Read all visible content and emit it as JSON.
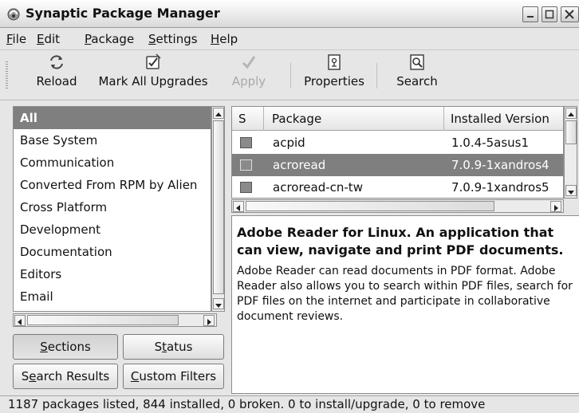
{
  "window": {
    "title": "Synaptic Package Manager",
    "app_icon": "synaptic-icon",
    "controls": [
      "minimize-icon",
      "maximize-icon",
      "close-icon"
    ]
  },
  "menu": [
    {
      "mnemonic": "F",
      "rest": "ile"
    },
    {
      "mnemonic": "E",
      "rest": "dit"
    },
    {
      "mnemonic": "P",
      "rest": "ackage"
    },
    {
      "mnemonic": "S",
      "rest": "ettings"
    },
    {
      "mnemonic": "H",
      "rest": "elp"
    }
  ],
  "toolbar": {
    "reload": {
      "label": "Reload",
      "icon": "reload-icon"
    },
    "mark_all": {
      "label": "Mark All Upgrades",
      "icon": "mark-all-upgrades-icon"
    },
    "apply": {
      "label": "Apply",
      "icon": "apply-checkmark-icon",
      "disabled": true
    },
    "properties": {
      "label": "Properties",
      "icon": "properties-icon"
    },
    "search": {
      "label": "Search",
      "icon": "search-icon"
    }
  },
  "sections": {
    "items": [
      "All",
      "Base System",
      "Communication",
      "Converted From RPM by Alien",
      "Cross Platform",
      "Development",
      "Documentation",
      "Editors",
      "Email"
    ],
    "selected_index": 0
  },
  "filter_buttons": {
    "sections": {
      "pre": "",
      "mnemonic": "S",
      "post": "ections"
    },
    "status": {
      "pre": "S",
      "mnemonic": "t",
      "post": "atus"
    },
    "search_results": {
      "pre": "S",
      "mnemonic": "e",
      "post": "arch Results"
    },
    "custom_filters": {
      "pre": "",
      "mnemonic": "C",
      "post": "ustom Filters"
    }
  },
  "packages": {
    "columns": [
      "S",
      "Package",
      "Installed Version"
    ],
    "rows": [
      {
        "name": "acpid",
        "installed_version": "1.0.4-5asus1"
      },
      {
        "name": "acroread",
        "installed_version": "7.0.9-1xandros4"
      },
      {
        "name": "acroread-cn-tw",
        "installed_version": "7.0.9-1xandros5"
      }
    ],
    "selected_index": 1
  },
  "description": {
    "title": "Adobe Reader for Linux. An application that can view, navigate and print PDF documents.",
    "body": "Adobe Reader can read documents in PDF format. Adobe Reader also allows you to search within PDF files, search for PDF files on the internet and participate in collaborative document reviews."
  },
  "status_bar": "1187 packages listed, 844 installed, 0 broken. 0 to install/upgrade, 0 to remove",
  "colors": {
    "selection": "#7f7f7f",
    "background": "#e6e6e6"
  }
}
